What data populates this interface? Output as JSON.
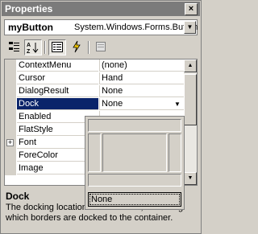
{
  "window": {
    "title": "Properties"
  },
  "object_selector": {
    "object_name": "myButton",
    "object_type": "System.Windows.Forms.Button"
  },
  "toolbar": {
    "buttons": [
      "categorized-icon",
      "alphabetical-icon",
      "properties-icon",
      "events-icon",
      "property-pages-icon"
    ]
  },
  "properties": [
    {
      "name": "ContextMenu",
      "value": "(none)"
    },
    {
      "name": "Cursor",
      "value": "Hand"
    },
    {
      "name": "DialogResult",
      "value": "None"
    },
    {
      "name": "Dock",
      "value": "None"
    },
    {
      "name": "Enabled",
      "value": ""
    },
    {
      "name": "FlatStyle",
      "value": ""
    },
    {
      "name": "Font",
      "value": ""
    },
    {
      "name": "ForeColor",
      "value": ""
    },
    {
      "name": "Image",
      "value": ""
    }
  ],
  "dock_editor": {
    "none_label": "None"
  },
  "description": {
    "name": "Dock",
    "text": "The docking location of the control, indicating which borders are docked to the container."
  },
  "colors": {
    "selection": "#0a246a",
    "chrome": "#d4d0c8"
  }
}
